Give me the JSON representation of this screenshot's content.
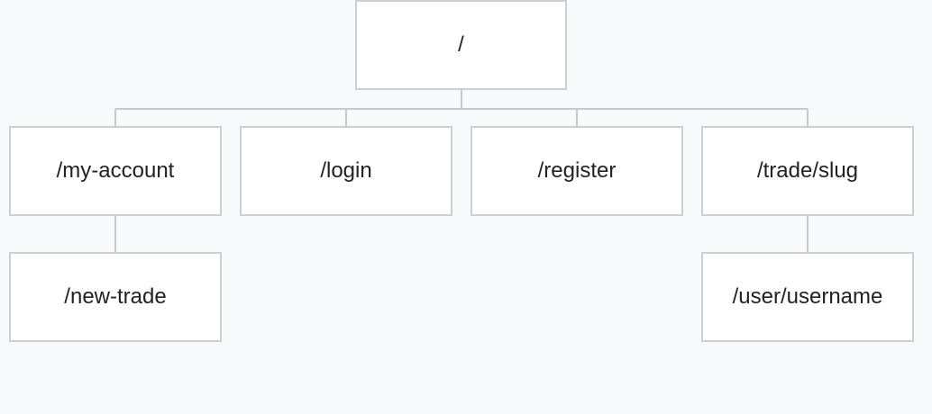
{
  "sitemap": {
    "root": {
      "label": "/"
    },
    "children": [
      {
        "label": "/my-account",
        "children": [
          {
            "label": "/new-trade"
          }
        ]
      },
      {
        "label": "/login"
      },
      {
        "label": "/register"
      },
      {
        "label": "/trade/slug",
        "children": [
          {
            "label": "/user/username"
          }
        ]
      }
    ]
  },
  "colors": {
    "background": "#f8f9fb",
    "node_fill": "#ffffff",
    "node_border": "#cfcfcf",
    "connector": "#c8c8c8",
    "text": "#222222"
  }
}
